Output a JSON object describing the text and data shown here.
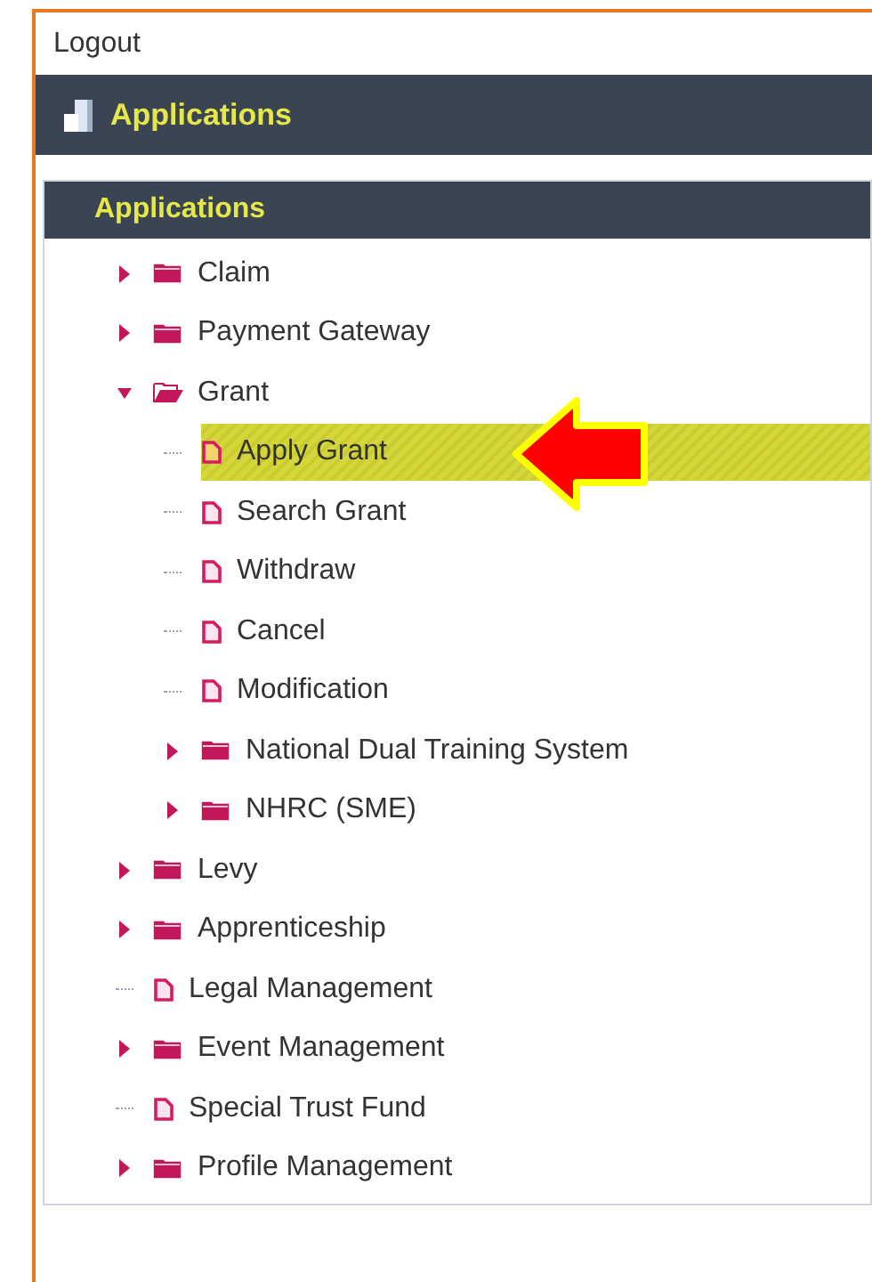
{
  "top_link": "Logout",
  "header": {
    "title": "Applications"
  },
  "panel": {
    "title": "Applications"
  },
  "tree": [
    {
      "label": "Claim",
      "kind": "folder",
      "expanded": false,
      "selected": false
    },
    {
      "label": "Payment Gateway",
      "kind": "folder",
      "expanded": false,
      "selected": false
    },
    {
      "label": "Grant",
      "kind": "folder",
      "expanded": true,
      "selected": false,
      "children": [
        {
          "label": "Apply Grant",
          "kind": "file",
          "selected": true
        },
        {
          "label": "Search Grant",
          "kind": "file",
          "selected": false
        },
        {
          "label": "Withdraw",
          "kind": "file",
          "selected": false
        },
        {
          "label": "Cancel",
          "kind": "file",
          "selected": false
        },
        {
          "label": "Modification",
          "kind": "file",
          "selected": false
        },
        {
          "label": "National Dual Training System",
          "kind": "folder",
          "expanded": false,
          "selected": false
        },
        {
          "label": "NHRC (SME)",
          "kind": "folder",
          "expanded": false,
          "selected": false
        }
      ]
    },
    {
      "label": "Levy",
      "kind": "folder",
      "expanded": false,
      "selected": false
    },
    {
      "label": "Apprenticeship",
      "kind": "folder",
      "expanded": false,
      "selected": false
    },
    {
      "label": "Legal Management",
      "kind": "file",
      "selected": false
    },
    {
      "label": "Event Management",
      "kind": "folder",
      "expanded": false,
      "selected": false
    },
    {
      "label": "Special Trust Fund",
      "kind": "file",
      "selected": false
    },
    {
      "label": "Profile Management",
      "kind": "folder",
      "expanded": false,
      "selected": false
    }
  ]
}
